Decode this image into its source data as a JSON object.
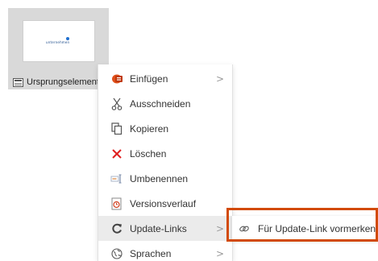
{
  "source_element": {
    "label": "Ursprungselement",
    "thumbnail_logo_text": "unternehmen"
  },
  "context_menu": {
    "items": [
      {
        "id": "insert",
        "label": "Einfügen",
        "icon": "insert-icon",
        "has_submenu": true
      },
      {
        "id": "cut",
        "label": "Ausschneiden",
        "icon": "scissors-icon",
        "has_submenu": false
      },
      {
        "id": "copy",
        "label": "Kopieren",
        "icon": "copy-icon",
        "has_submenu": false
      },
      {
        "id": "delete",
        "label": "Löschen",
        "icon": "delete-x-icon",
        "has_submenu": false
      },
      {
        "id": "rename",
        "label": "Umbenennen",
        "icon": "rename-icon",
        "has_submenu": false
      },
      {
        "id": "history",
        "label": "Versionsverlauf",
        "icon": "version-history-icon",
        "has_submenu": false
      },
      {
        "id": "update-links",
        "label": "Update-Links",
        "icon": "refresh-icon",
        "has_submenu": true,
        "active": true
      },
      {
        "id": "languages",
        "label": "Sprachen",
        "icon": "globe-icon",
        "has_submenu": true
      }
    ],
    "submenu_arrow": ">"
  },
  "submenu": {
    "items": [
      {
        "id": "mark-for-update",
        "label": "Für Update-Link vormerken",
        "icon": "link-mark-icon"
      }
    ]
  },
  "colors": {
    "highlight_border": "#d24a06",
    "delete_icon": "#e02020",
    "insert_icon": "#e0501b",
    "active_row": "#ebebeb"
  }
}
